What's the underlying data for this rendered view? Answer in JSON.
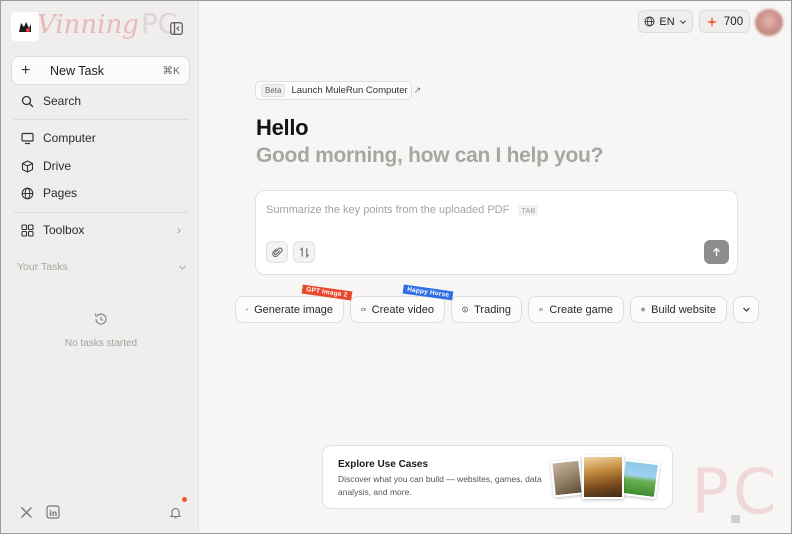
{
  "app": {
    "logo_text": "Vinning",
    "logo_suffix": "PC"
  },
  "sidebar": {
    "new_task": {
      "label": "New Task",
      "shortcut": "⌘K"
    },
    "search": {
      "label": "Search"
    },
    "items": [
      {
        "label": "Computer",
        "icon": "monitor-icon"
      },
      {
        "label": "Drive",
        "icon": "box-icon"
      },
      {
        "label": "Pages",
        "icon": "globe-icon"
      }
    ],
    "toolbox": {
      "label": "Toolbox",
      "icon": "grid-icon"
    },
    "tasks_section": {
      "label": "Your Tasks"
    },
    "empty_state": "No tasks started",
    "footer": {
      "icons": [
        "x-icon",
        "linkedin-icon",
        "bell-icon"
      ]
    }
  },
  "header": {
    "language": "EN",
    "credits": "700"
  },
  "main": {
    "beta_pill": {
      "tag": "Beta",
      "label": "Launch MuleRun Computer"
    },
    "hello": "Hello",
    "greeting": "Good morning, how can I help you?",
    "composer": {
      "placeholder": "Summarize the key points from the uploaded PDF",
      "tab_hint": "TAB"
    },
    "chips": [
      {
        "label": "Generate image",
        "icon": "image-icon",
        "ribbon": "GPT Image 2",
        "ribbon_color": "#e8472e"
      },
      {
        "label": "Create video",
        "icon": "video-icon",
        "ribbon": "Happy Horse",
        "ribbon_color": "#2f6fe4"
      },
      {
        "label": "Trading",
        "icon": "dollar-icon"
      },
      {
        "label": "Create game",
        "icon": "gamepad-icon"
      },
      {
        "label": "Build website",
        "icon": "globe-icon"
      }
    ],
    "explore": {
      "title": "Explore Use Cases",
      "description": "Discover what you can build — websites, games, data analysis, and more."
    }
  },
  "watermark": {
    "text": "PC"
  },
  "colors": {
    "accent": "#f05a28",
    "background": "#f7f6f4",
    "sidebar": "#efeeec"
  }
}
